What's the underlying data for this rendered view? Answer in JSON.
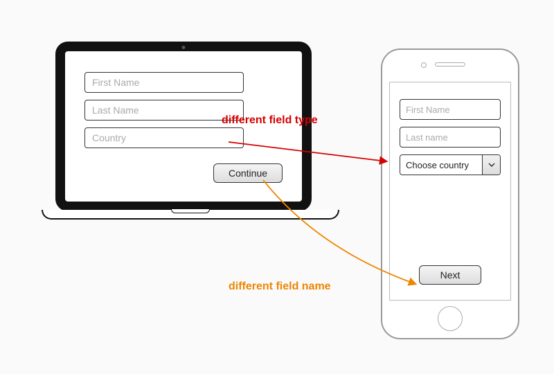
{
  "laptop": {
    "fields": {
      "first_name_placeholder": "First Name",
      "last_name_placeholder": "Last Name",
      "country_placeholder": "Country"
    },
    "submit_label": "Continue"
  },
  "phone": {
    "fields": {
      "first_name_placeholder": "First Name",
      "last_name_placeholder": "Last name",
      "country_select_label": "Choose country"
    },
    "submit_label": "Next"
  },
  "annotations": {
    "field_type": "different field type",
    "field_name": "different field name"
  },
  "colors": {
    "red": "#d50000",
    "orange": "#ee8500"
  }
}
